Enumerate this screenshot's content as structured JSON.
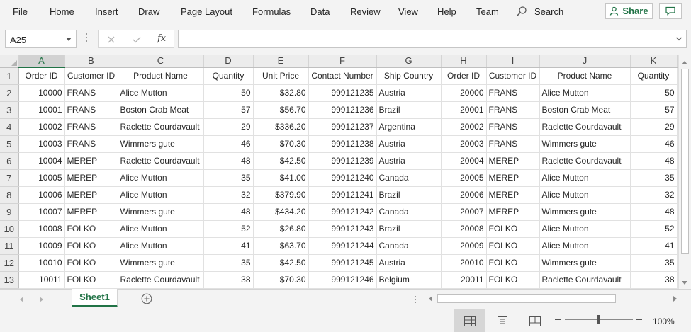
{
  "ribbon": {
    "tabs": [
      "File",
      "Home",
      "Insert",
      "Draw",
      "Page Layout",
      "Formulas",
      "Data",
      "Review",
      "View",
      "Help",
      "Team"
    ],
    "search_label": "Search",
    "share_label": "Share"
  },
  "formula_bar": {
    "name_box": "A25",
    "fx_label": "fx",
    "formula_value": ""
  },
  "grid": {
    "selected_column": "A",
    "column_letters": [
      "A",
      "B",
      "C",
      "D",
      "E",
      "F",
      "G",
      "H",
      "I",
      "J",
      "K"
    ],
    "row_numbers": [
      "1",
      "2",
      "3",
      "4",
      "5",
      "6",
      "7",
      "8",
      "9",
      "10",
      "11",
      "12",
      "13"
    ],
    "headers": [
      "Order ID",
      "Customer ID",
      "Product Name",
      "Quantity",
      "Unit Price",
      "Contact Number",
      "Ship Country",
      "Order ID",
      "Customer ID",
      "Product Name",
      "Quantity"
    ],
    "rows": [
      [
        "10000",
        "FRANS",
        "Alice Mutton",
        "50",
        "$32.80",
        "999121235",
        "Austria",
        "20000",
        "FRANS",
        "Alice Mutton",
        "50"
      ],
      [
        "10001",
        "FRANS",
        "Boston Crab Meat",
        "57",
        "$56.70",
        "999121236",
        "Brazil",
        "20001",
        "FRANS",
        "Boston Crab Meat",
        "57"
      ],
      [
        "10002",
        "FRANS",
        "Raclette Courdavault",
        "29",
        "$336.20",
        "999121237",
        "Argentina",
        "20002",
        "FRANS",
        "Raclette Courdavault",
        "29"
      ],
      [
        "10003",
        "FRANS",
        "Wimmers gute",
        "46",
        "$70.30",
        "999121238",
        "Austria",
        "20003",
        "FRANS",
        "Wimmers gute",
        "46"
      ],
      [
        "10004",
        "MEREP",
        "Raclette Courdavault",
        "48",
        "$42.50",
        "999121239",
        "Austria",
        "20004",
        "MEREP",
        "Raclette Courdavault",
        "48"
      ],
      [
        "10005",
        "MEREP",
        "Alice Mutton",
        "35",
        "$41.00",
        "999121240",
        "Canada",
        "20005",
        "MEREP",
        "Alice Mutton",
        "35"
      ],
      [
        "10006",
        "MEREP",
        "Alice Mutton",
        "32",
        "$379.90",
        "999121241",
        "Brazil",
        "20006",
        "MEREP",
        "Alice Mutton",
        "32"
      ],
      [
        "10007",
        "MEREP",
        "Wimmers gute",
        "48",
        "$434.20",
        "999121242",
        "Canada",
        "20007",
        "MEREP",
        "Wimmers gute",
        "48"
      ],
      [
        "10008",
        "FOLKO",
        "Alice Mutton",
        "52",
        "$26.80",
        "999121243",
        "Brazil",
        "20008",
        "FOLKO",
        "Alice Mutton",
        "52"
      ],
      [
        "10009",
        "FOLKO",
        "Alice Mutton",
        "41",
        "$63.70",
        "999121244",
        "Canada",
        "20009",
        "FOLKO",
        "Alice Mutton",
        "41"
      ],
      [
        "10010",
        "FOLKO",
        "Wimmers gute",
        "35",
        "$42.50",
        "999121245",
        "Austria",
        "20010",
        "FOLKO",
        "Wimmers gute",
        "35"
      ],
      [
        "10011",
        "FOLKO",
        "Raclette Courdavault",
        "38",
        "$70.30",
        "999121246",
        "Belgium",
        "20011",
        "FOLKO",
        "Raclette Courdavault",
        "38"
      ]
    ]
  },
  "sheets": {
    "active_tab": "Sheet1"
  },
  "status": {
    "zoom_label": "100%",
    "zoom_level_percent": 100
  },
  "colors": {
    "accent": "#217346",
    "chrome_bg": "#f3f3f3",
    "gridline": "#e1e1e1",
    "header_bg": "#ececec"
  }
}
